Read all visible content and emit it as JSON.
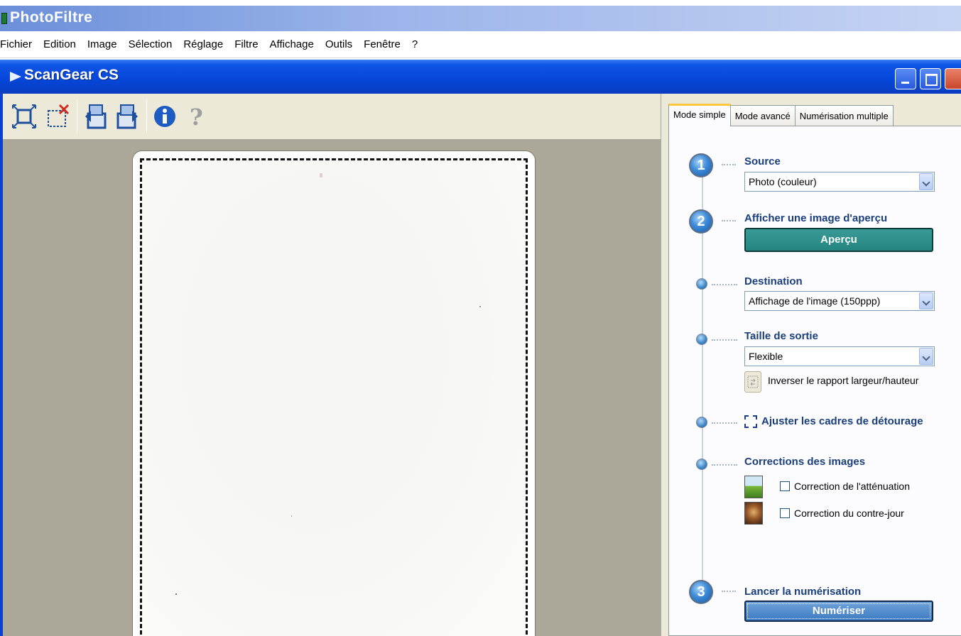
{
  "app": {
    "title": "PhotoFiltre"
  },
  "menu": [
    "Fichier",
    "Edition",
    "Image",
    "Sélection",
    "Réglage",
    "Filtre",
    "Affichage",
    "Outils",
    "Fenêtre",
    "?"
  ],
  "dialog": {
    "title": "ScanGear CS"
  },
  "toolbar": {
    "icons": [
      "crop-icon",
      "clear-crop-icon",
      "rotate-left-icon",
      "rotate-right-icon",
      "info-icon",
      "help-icon"
    ]
  },
  "tabs": [
    {
      "label": "Mode simple",
      "active": true
    },
    {
      "label": "Mode avancé",
      "active": false
    },
    {
      "label": "Numérisation multiple",
      "active": false
    }
  ],
  "steps": [
    {
      "number": "1",
      "title": "Source",
      "value": "Photo (couleur)"
    },
    {
      "number": "2",
      "title": "Afficher une image d'aperçu",
      "button": "Aperçu"
    },
    {
      "title": "Destination",
      "value": "Affichage de l'image (150ppp)"
    },
    {
      "title": "Taille de sortie",
      "value": "Flexible",
      "swap_label": "Inverser le rapport largeur/hauteur"
    },
    {
      "title": "Ajuster les cadres de détourage"
    },
    {
      "title": "Corrections des images",
      "options": [
        {
          "label": "Correction de l'atténuation",
          "checked": false
        },
        {
          "label": "Correction du contre-jour",
          "checked": false
        }
      ]
    },
    {
      "number": "3",
      "title": "Lancer la numérisation",
      "button": "Numériser"
    }
  ],
  "colors": {
    "xp_blue": "#0646d8",
    "panel_bg": "#ece9d8",
    "preview_bg": "#aca899",
    "apercu_button": "#258580",
    "section_title": "#1a3f7a"
  }
}
